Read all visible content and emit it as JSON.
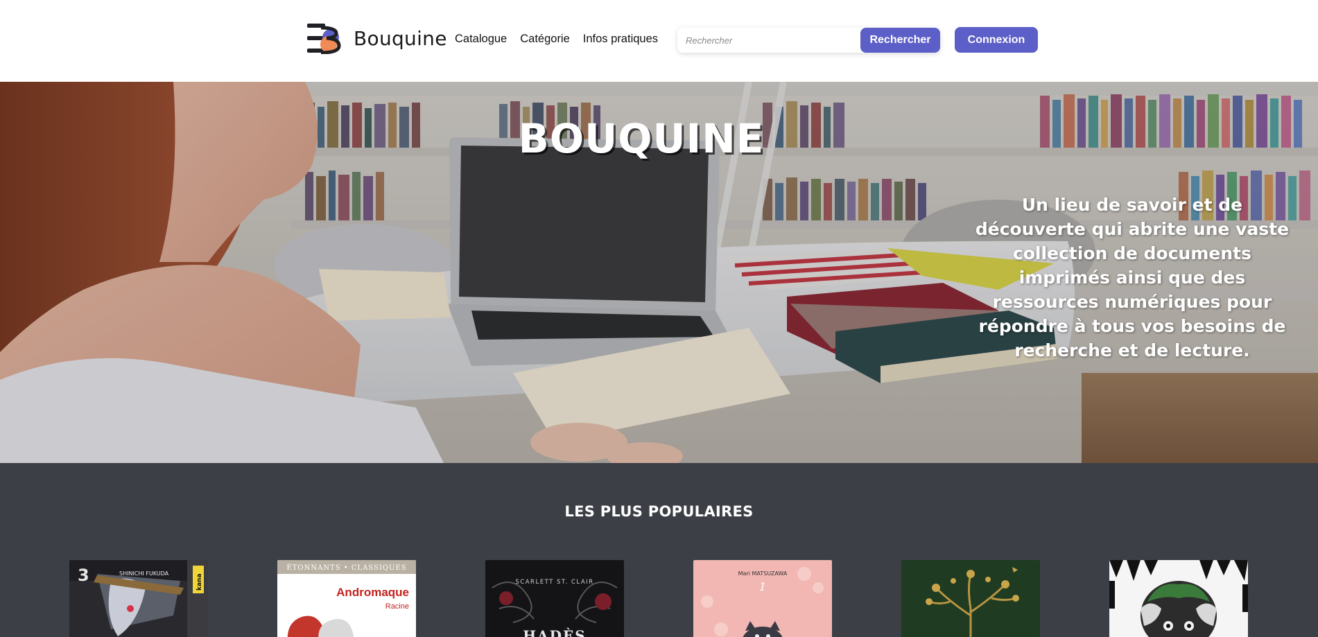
{
  "header": {
    "logo_text": "Bouquine",
    "nav": [
      "Catalogue",
      "Catégorie",
      "Infos pratiques"
    ],
    "search_placeholder": "Rechercher",
    "search_button": "Rechercher",
    "login_button": "Connexion"
  },
  "hero": {
    "title": "BOUQUINE",
    "description": "Un lieu de savoir et de découverte qui abrite une vaste collection de documents imprimés ainsi que des ressources numériques pour répondre à tous vos besoins de recherche et de lecture."
  },
  "popular": {
    "title": "LES PLUS POPULAIRES",
    "books": [
      {
        "number": "3",
        "author": "SHINICHI FUKUDA",
        "publisher": "kana"
      },
      {
        "series": "ÉTONNANTS • CLASSIQUES",
        "title": "Andromaque",
        "author": "Racine"
      },
      {
        "author": "SCARLETT ST. CLAIR",
        "title": "HADÈS"
      },
      {
        "author": "Mari MATSUZAWA",
        "number": "1"
      },
      {},
      {}
    ]
  },
  "colors": {
    "accent": "#5b5fc7",
    "section_bg": "#3c3f46"
  }
}
